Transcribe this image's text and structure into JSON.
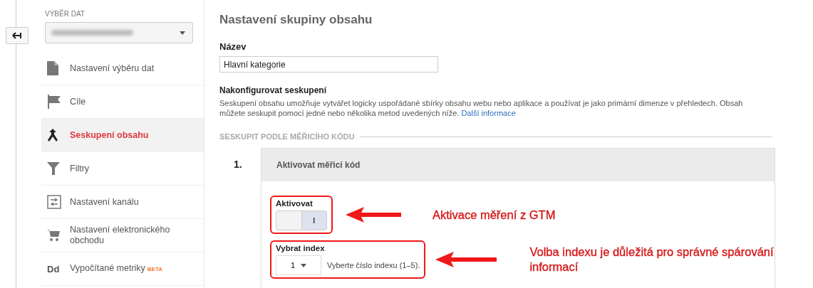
{
  "sidebar": {
    "heading": "VÝBĚR DAT",
    "items": [
      {
        "label": "Nastavení výběru dat",
        "selected": false
      },
      {
        "label": "Cíle",
        "selected": false
      },
      {
        "label": "Seskupení obsahu",
        "selected": true
      },
      {
        "label": "Filtry",
        "selected": false
      },
      {
        "label": "Nastavení kanálu",
        "selected": false
      },
      {
        "label": "Nastavení elektronického obchodu",
        "selected": false
      },
      {
        "label": "Vypočítané metriky",
        "icon_text": "Dd",
        "badge": "BETA",
        "selected": false
      }
    ]
  },
  "main": {
    "title": "Nastavení skupiny obsahu",
    "name_label": "Název",
    "name_value": "Hlavní kategorie",
    "config_heading": "Nakonfigurovat seskupení",
    "description": "Seskupení obsahu umožňuje vytvářet logicky uspořádané sbírky obsahu webu nebo aplikace a používat je jako primární dimenze v přehledech. Obsah můžete seskupit pomocí jedné nebo několika metod uvedených níže.",
    "link": "Další informace",
    "section": "SESKUPIT PODLE MĚŘICÍHO KÓDU",
    "step": {
      "number": "1.",
      "title": "Aktivovat měřicí kód",
      "toggle": {
        "label": "Aktivovat",
        "on": true,
        "text": "I"
      },
      "index": {
        "label": "Vybrat index",
        "value": "1",
        "hint": "Vyberte číslo indexu (1–5)."
      }
    }
  },
  "annotations": [
    {
      "text": "Aktivace měření z GTM"
    },
    {
      "text": "Volba indexu je důležitá pro správné spárování informací"
    }
  ]
}
